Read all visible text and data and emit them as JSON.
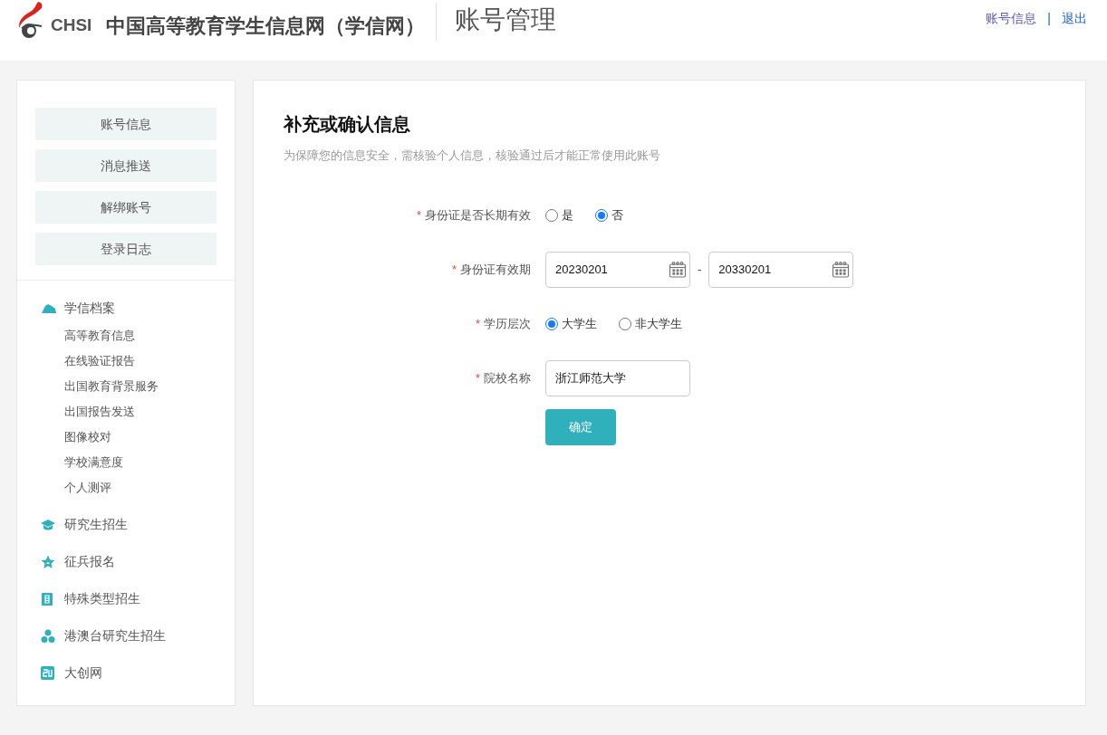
{
  "header": {
    "logo_text": "CHSI",
    "site_name": "中国高等教育学生信息网（学信网）",
    "page_title": "账号管理",
    "links": [
      {
        "label": "账号信息"
      },
      {
        "label": "退出"
      }
    ],
    "separator": "|"
  },
  "sidebar": {
    "buttons": [
      "账号信息",
      "消息推送",
      "解绑账号",
      "登录日志"
    ],
    "sections": [
      {
        "label": "学信档案",
        "children": [
          "高等教育信息",
          "在线验证报告",
          "出国教育背景服务",
          "出国报告发送",
          "图像校对",
          "学校满意度",
          "个人测评"
        ]
      },
      {
        "label": "研究生招生"
      },
      {
        "label": "征兵报名"
      },
      {
        "label": "特殊类型招生"
      },
      {
        "label": "港澳台研究生招生"
      },
      {
        "label": "大创网"
      }
    ]
  },
  "form": {
    "title": "补充或确认信息",
    "subtitle": "为保障您的信息安全，需核验个人信息，核验通过后才能正常使用此账号",
    "rows": [
      {
        "kind": "radio",
        "label": "身份证是否长期有效",
        "required_mark": "*",
        "options": [
          {
            "label": "是",
            "selected": false
          },
          {
            "label": "否",
            "selected": true
          }
        ]
      },
      {
        "kind": "daterange",
        "label": "身份证有效期",
        "required_mark": "*",
        "start": "20230201",
        "separator": "-",
        "end": "20330201"
      },
      {
        "kind": "radio",
        "label": "学历层次",
        "required_mark": "*",
        "options": [
          {
            "label": "大学生",
            "selected": true
          },
          {
            "label": "非大学生",
            "selected": false
          }
        ]
      },
      {
        "kind": "text",
        "label": "院校名称",
        "required_mark": "*",
        "value": "浙江师范大学"
      }
    ],
    "submit": "确定"
  }
}
